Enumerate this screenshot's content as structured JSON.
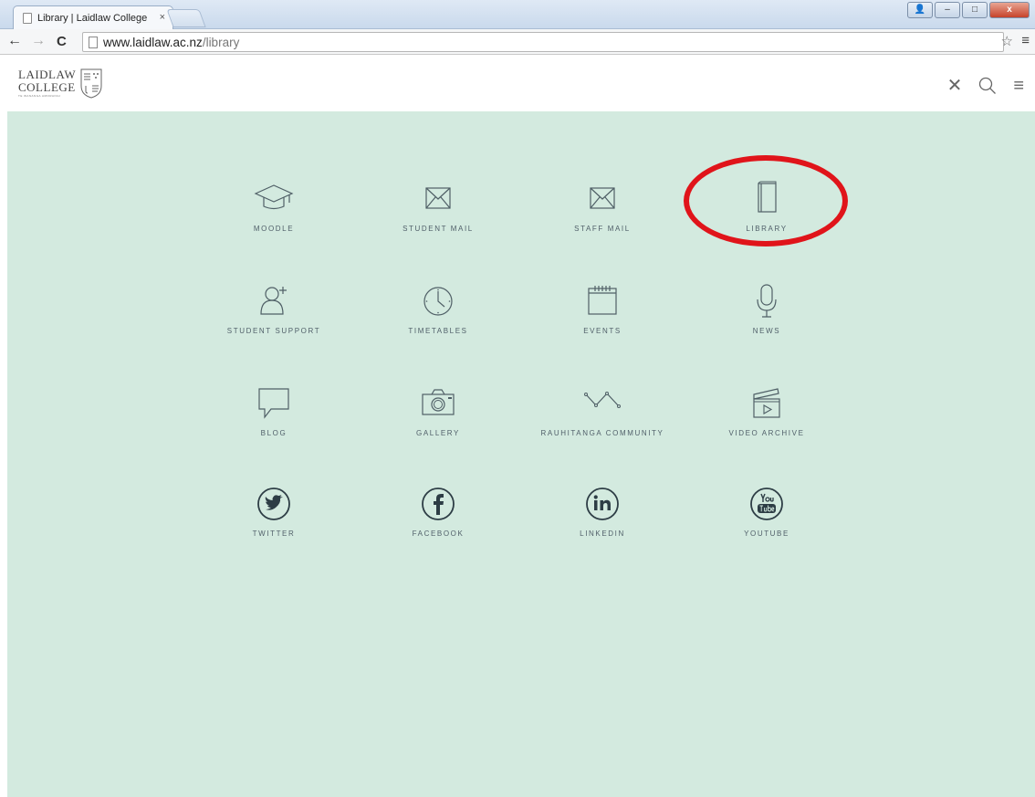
{
  "browser": {
    "tab_title": "Library | Laidlaw College",
    "tab_close": "×",
    "url_host": "www.laidlaw.ac.nz",
    "url_path": "/library",
    "back": "←",
    "forward": "→",
    "reload": "C",
    "star": "☆",
    "menu": "≡",
    "window_buttons": {
      "account": "👤",
      "minimize": "–",
      "maximize": "□",
      "close": "x"
    }
  },
  "header": {
    "logo_line1": "LAIDLAW",
    "logo_line2": "COLLEGE",
    "logo_tagline": "TE WANANGA AMORANGI",
    "icons": [
      "close-icon",
      "search-icon",
      "hamburger-menu-icon"
    ],
    "icon_glyphs": {
      "close": "✕",
      "search": "⚲",
      "menu": "≡"
    }
  },
  "tiles": [
    {
      "label": "MOODLE",
      "icon": "graduation-cap-icon"
    },
    {
      "label": "STUDENT MAIL",
      "icon": "envelope-icon"
    },
    {
      "label": "STAFF MAIL",
      "icon": "envelope-icon"
    },
    {
      "label": "LIBRARY",
      "icon": "book-icon"
    },
    {
      "label": "STUDENT SUPPORT",
      "icon": "add-person-icon"
    },
    {
      "label": "TIMETABLES",
      "icon": "clock-icon"
    },
    {
      "label": "EVENTS",
      "icon": "calendar-icon"
    },
    {
      "label": "NEWS",
      "icon": "microphone-icon"
    },
    {
      "label": "BLOG",
      "icon": "speech-bubble-icon"
    },
    {
      "label": "GALLERY",
      "icon": "camera-icon"
    },
    {
      "label": "RAUHITANGA COMMUNITY",
      "icon": "zigzag-network-icon"
    },
    {
      "label": "VIDEO ARCHIVE",
      "icon": "clapperboard-icon"
    },
    {
      "label": "TWITTER",
      "icon": "twitter-icon"
    },
    {
      "label": "FACEBOOK",
      "icon": "facebook-icon"
    },
    {
      "label": "LINKEDIN",
      "icon": "linkedin-icon"
    },
    {
      "label": "YOUTUBE",
      "icon": "youtube-icon"
    }
  ],
  "colors": {
    "main_bg": "#d3eadf",
    "icon_stroke": "#4f5f66",
    "highlight": "#e0141a"
  }
}
